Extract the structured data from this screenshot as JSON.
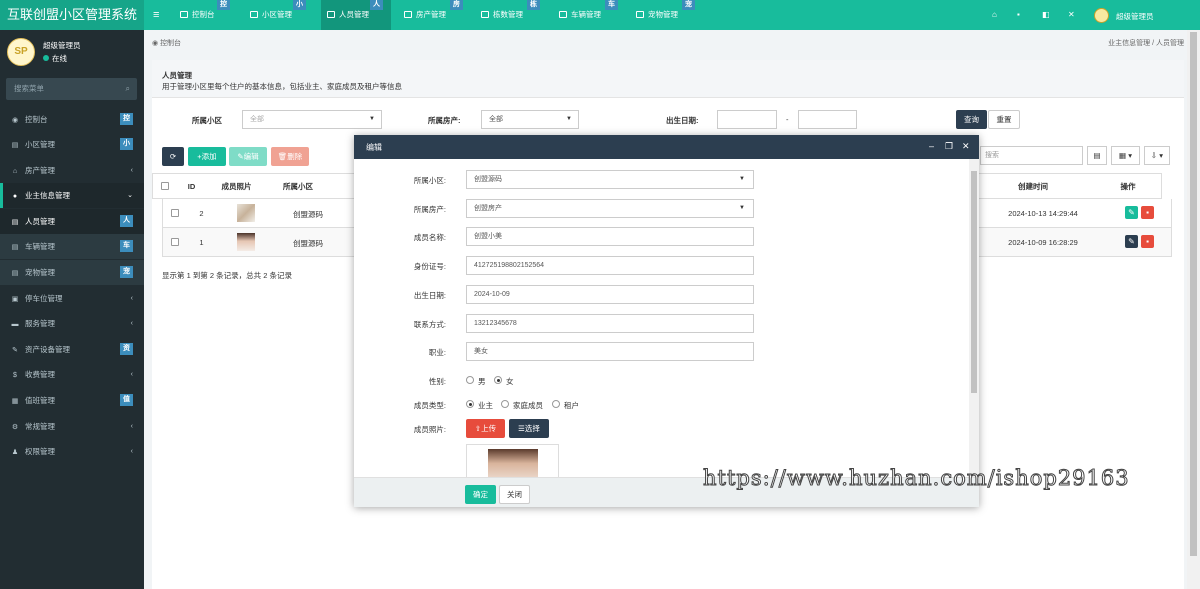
{
  "app": {
    "title": "互联创盟小区管理系统"
  },
  "top_tabs": [
    {
      "label": "控制台",
      "badge": "控",
      "icon": "dashboard-icon"
    },
    {
      "label": "小区管理",
      "badge": "小",
      "icon": "list-icon"
    },
    {
      "label": "人员管理",
      "badge": "人",
      "icon": "user-icon",
      "active": true
    },
    {
      "label": "房产管理",
      "badge": "房",
      "icon": "list-icon"
    },
    {
      "label": "栋数管理",
      "badge": "栋",
      "icon": "list-icon"
    },
    {
      "label": "车辆管理",
      "badge": "车",
      "icon": "list-icon"
    },
    {
      "label": "宠物管理",
      "badge": "宠",
      "icon": "list-icon"
    }
  ],
  "top_right": {
    "icons": [
      "home-icon",
      "trash-icon",
      "language-icon",
      "fullscreen-icon"
    ],
    "user": "超级管理员"
  },
  "sidebar": {
    "user": {
      "name": "超级管理员",
      "status": "在线",
      "avatar": "SP"
    },
    "search_placeholder": "搜索菜单",
    "items": [
      {
        "label": "控制台",
        "badge": "控",
        "icon": "dashboard-icon"
      },
      {
        "label": "小区管理",
        "badge": "小",
        "icon": "list-icon"
      },
      {
        "label": "房产管理",
        "arrow": "‹",
        "icon": "home-icon"
      },
      {
        "label": "业主信息管理",
        "arrow": "⌄",
        "icon": "user-icon",
        "open": true
      },
      {
        "label": "人员管理",
        "badge": "人",
        "icon": "list-icon",
        "sub": true,
        "current": true
      },
      {
        "label": "车辆管理",
        "badge": "车",
        "icon": "list-icon",
        "sub": true
      },
      {
        "label": "宠物管理",
        "badge": "宠",
        "icon": "list-icon",
        "sub": true
      },
      {
        "label": "停车位管理",
        "arrow": "‹",
        "icon": "parking-icon"
      },
      {
        "label": "服务管理",
        "arrow": "‹",
        "icon": "service-icon"
      },
      {
        "label": "资产设备管理",
        "badge": "资",
        "icon": "wrench-icon"
      },
      {
        "label": "收费管理",
        "arrow": "‹",
        "icon": "dollar-icon"
      },
      {
        "label": "值班管理",
        "badge": "值",
        "icon": "calendar-icon"
      },
      {
        "label": "常规管理",
        "arrow": "‹",
        "icon": "cogs-icon"
      },
      {
        "label": "权限管理",
        "arrow": "‹",
        "icon": "group-icon"
      }
    ]
  },
  "breadcrumb": {
    "home": "控制台",
    "path": "业主信息管理 / 人员管理"
  },
  "panel": {
    "title": "人员管理",
    "description": "用于管理小区里每个住户的基本信息，包括业主、家庭成员及租户等信息"
  },
  "filters": {
    "community_label": "所属小区",
    "community_value": "全部",
    "house_label": "所属房产:",
    "house_value": "全部",
    "birth_label": "出生日期:",
    "dash": "-",
    "search_btn": "查询",
    "reset_btn": "重置"
  },
  "toolbar": {
    "refresh": "⟳",
    "add": "+添加",
    "edit": "✎编辑",
    "delete": "🗑删除",
    "search_placeholder": "搜索"
  },
  "table": {
    "headers": [
      "ID",
      "成员照片",
      "所属小区",
      "创建时间",
      "操作"
    ],
    "rows": [
      {
        "id": "2",
        "community": "创盟源码",
        "created": "2024-10-13 14:29:44"
      },
      {
        "id": "1",
        "community": "创盟源码",
        "created": "2024-10-09 16:28:29"
      }
    ],
    "summary": "显示第 1 到第 2 条记录，总共 2 条记录"
  },
  "dialog": {
    "title": "编辑",
    "fields": {
      "community": {
        "label": "所属小区:",
        "value": "创盟源码"
      },
      "house": {
        "label": "所属房产:",
        "value": "创盟房产"
      },
      "name": {
        "label": "成员名称:",
        "value": "创盟小美"
      },
      "idcard": {
        "label": "身份证号:",
        "value": "412725198802152564"
      },
      "birth": {
        "label": "出生日期:",
        "value": "2024-10-09"
      },
      "phone": {
        "label": "联系方式:",
        "value": "13212345678"
      },
      "job": {
        "label": "职业:",
        "value": "美女"
      },
      "gender": {
        "label": "性别:",
        "options": [
          "男",
          "女"
        ],
        "selected": "女"
      },
      "type": {
        "label": "成员类型:",
        "options": [
          "业主",
          "家庭成员",
          "租户"
        ],
        "selected": "业主"
      },
      "photo": {
        "label": "成员照片:",
        "upload": "上传",
        "choose": "选择"
      }
    },
    "ok": "确定",
    "close": "关闭"
  },
  "watermark": "https://www.huzhan.com/ishop29163"
}
